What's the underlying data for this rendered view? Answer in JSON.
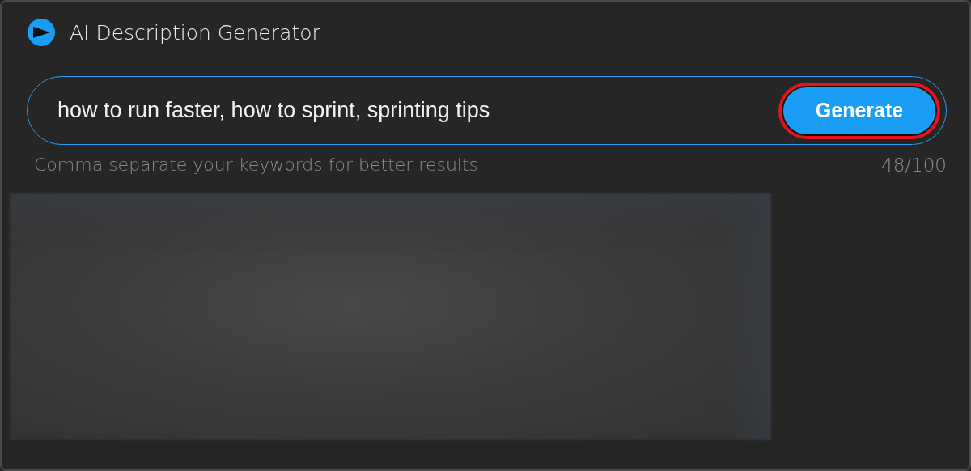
{
  "window": {
    "title": "AI Description Generator"
  },
  "keywords_field": {
    "value": "how to run faster, how to sprint, sprinting tips"
  },
  "generate_button": {
    "label": "Generate",
    "highlighted": true
  },
  "hint": "Comma separate your keywords for better results",
  "counter": "48/100",
  "result": {
    "kind": "blurred"
  }
}
